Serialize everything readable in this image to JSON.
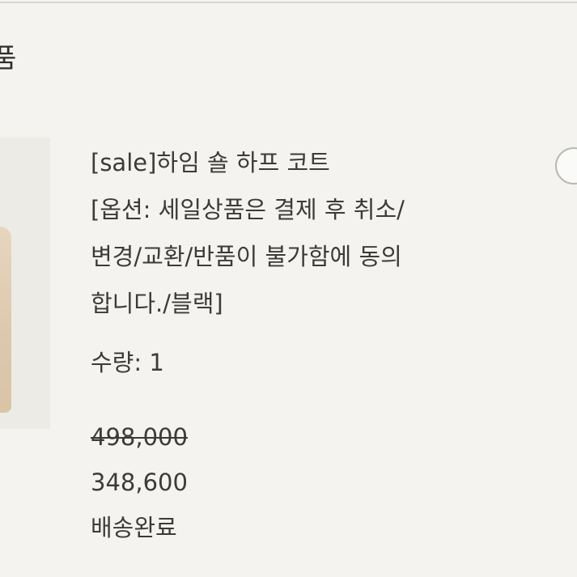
{
  "section": {
    "title": "품"
  },
  "product": {
    "name_lines": [
      "[sale]하임 숄 하프 코트",
      "[옵션: 세일상품은 결제 후 취소/",
      "변경/교환/반품이 불가함에 동의",
      "합니다./블랙]"
    ],
    "quantity_text": "수량: 1",
    "original_price": "498,000",
    "sale_price": "348,600",
    "delivery_status": "배송완료"
  },
  "colors": {
    "background": "#f4f3ef",
    "text": "#3b3b3b",
    "thumb_bg": "#ecebe6",
    "coat": "#dcc8ac"
  },
  "icons": {
    "select_toggle": "circle-checkbox-icon"
  }
}
